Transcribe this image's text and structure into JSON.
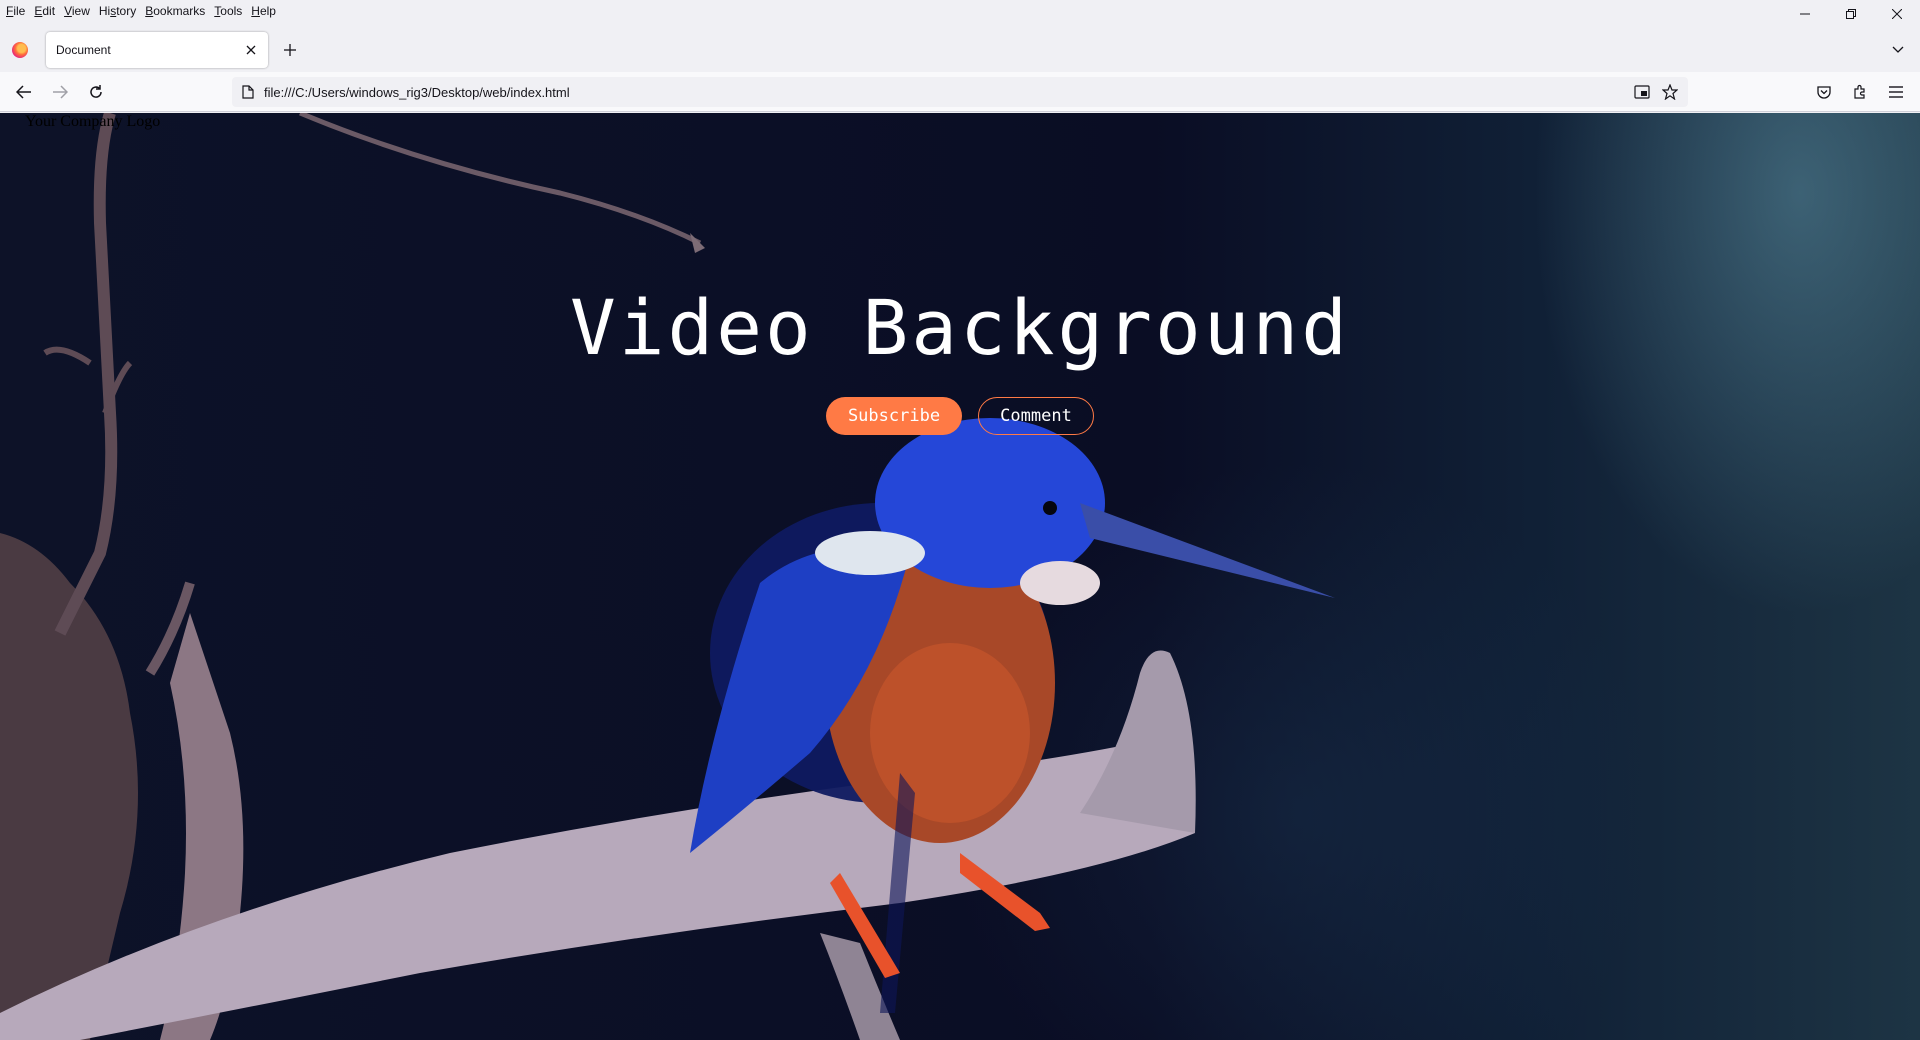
{
  "menu": {
    "items": [
      {
        "first": "F",
        "rest": "ile"
      },
      {
        "first": "E",
        "rest": "dit"
      },
      {
        "first": "V",
        "rest": "iew"
      },
      {
        "first": "Hi",
        "mid": "s",
        "rest": "tory"
      },
      {
        "first": "B",
        "rest": "ookmarks"
      },
      {
        "first": "T",
        "rest": "ools"
      },
      {
        "first": "H",
        "rest": "elp"
      }
    ]
  },
  "tab": {
    "title": "Document"
  },
  "address": {
    "url": "file:///C:/Users/windows_rig3/Desktop/web/index.html"
  },
  "page": {
    "logo": "Your Company Logo",
    "title": "Video Background",
    "subscribe_label": "Subscribe",
    "comment_label": "Comment"
  },
  "colors": {
    "accent": "#ff7a45",
    "background": "#0b0f26"
  },
  "icons": [
    "firefox-logo-icon",
    "close-icon",
    "plus-icon",
    "chevron-down-icon",
    "back-icon",
    "forward-icon",
    "reload-icon",
    "page-icon",
    "screenshot-icon",
    "star-icon",
    "pocket-icon",
    "extensions-icon",
    "menu-icon",
    "minimize-icon",
    "restore-icon",
    "window-close-icon"
  ]
}
